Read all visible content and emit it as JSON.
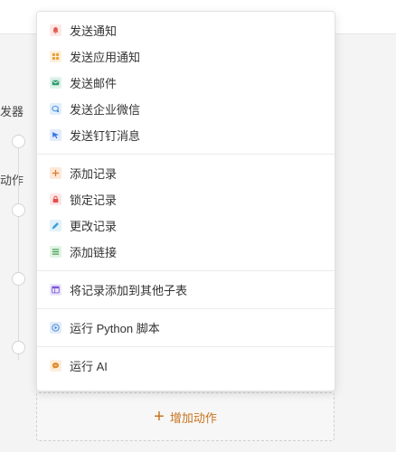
{
  "background": {
    "trigger_label": "发器",
    "action_label": "动作",
    "add_action_label": "增加动作",
    "add_action_icon": "plus-icon",
    "accent_color": "#d78a3a"
  },
  "menu": {
    "groups": [
      {
        "items": [
          {
            "label": "发送通知",
            "icon": "bell-icon",
            "icon_color": "#e05a4f",
            "icon_bg": "#fde9e7"
          },
          {
            "label": "发送应用通知",
            "icon": "app-grid-icon",
            "icon_color": "#e8a13a",
            "icon_bg": "#fdf1dd"
          },
          {
            "label": "发送邮件",
            "icon": "mail-icon",
            "icon_color": "#2f9d6e",
            "icon_bg": "#dff3ea"
          },
          {
            "label": "发送企业微信",
            "icon": "wecom-icon",
            "icon_color": "#3b8de0",
            "icon_bg": "#e3eefb"
          },
          {
            "label": "发送钉钉消息",
            "icon": "dingtalk-icon",
            "icon_color": "#3a78e6",
            "icon_bg": "#e2ebfc"
          }
        ]
      },
      {
        "items": [
          {
            "label": "添加记录",
            "icon": "plus-icon",
            "icon_color": "#e0782a",
            "icon_bg": "#fde8d8"
          },
          {
            "label": "锁定记录",
            "icon": "lock-icon",
            "icon_color": "#e0504f",
            "icon_bg": "#fde6e6"
          },
          {
            "label": "更改记录",
            "icon": "pencil-icon",
            "icon_color": "#3aa0d8",
            "icon_bg": "#e0f1fa"
          },
          {
            "label": "添加链接",
            "icon": "list-icon",
            "icon_color": "#3a9a4a",
            "icon_bg": "#e0f3e3"
          }
        ]
      },
      {
        "items": [
          {
            "label": "将记录添加到其他子表",
            "icon": "subtable-icon",
            "icon_color": "#7d5ad8",
            "icon_bg": "#ece6fb"
          }
        ]
      },
      {
        "items": [
          {
            "label": "运行 Python 脚本",
            "icon": "play-icon",
            "icon_color": "#3a80d8",
            "icon_bg": "#e2ecfa"
          }
        ]
      },
      {
        "items": [
          {
            "label": "运行 AI",
            "icon": "ai-chat-icon",
            "icon_color": "#e08a2a",
            "icon_bg": "#fdeede"
          }
        ]
      }
    ]
  }
}
